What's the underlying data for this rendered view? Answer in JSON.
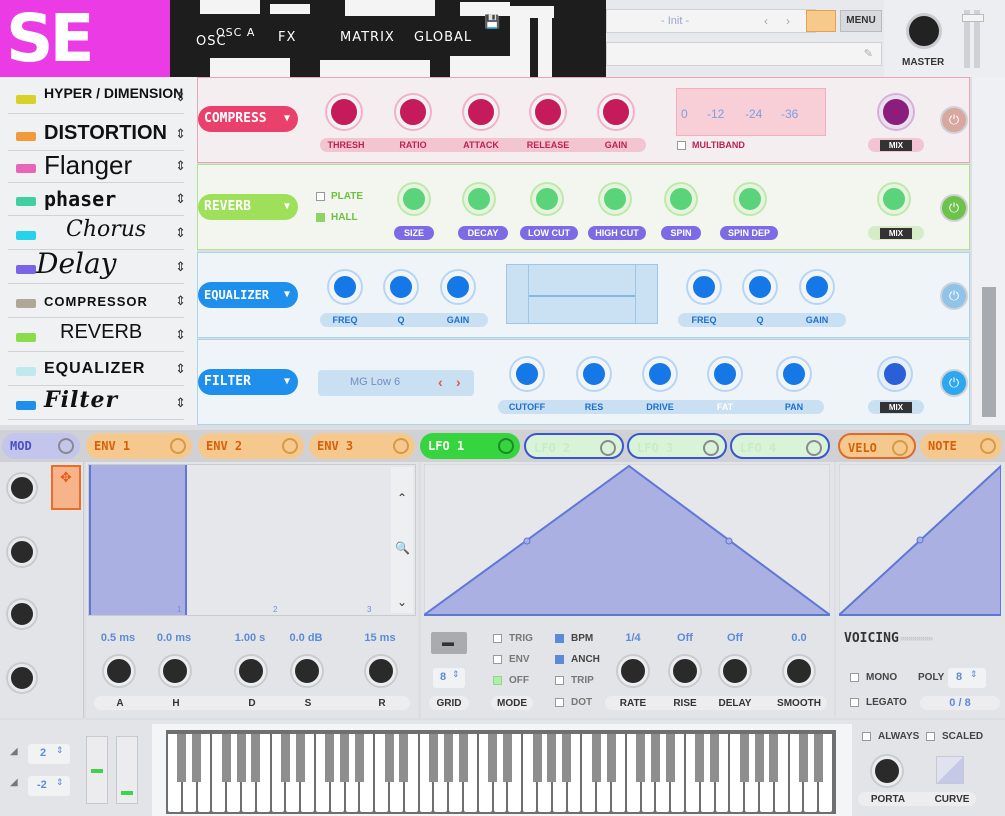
{
  "logo_text": "SE",
  "nav": {
    "osc_label": "OSC",
    "osc_sub": "OSC A",
    "fx": "FX",
    "matrix": "MATRIX",
    "global": "GLOBAL"
  },
  "preset": {
    "name": "- Init -",
    "menu": "MENU"
  },
  "master": {
    "label": "MASTER"
  },
  "fx_list": [
    {
      "name": "HYPER / DIMENSION",
      "color": "#d9d12a"
    },
    {
      "name": "DISTORTION",
      "color": "#f29a3a"
    },
    {
      "name": "Flanger",
      "color": "#e766b8"
    },
    {
      "name": "phaser",
      "color": "#3fcfa0"
    },
    {
      "name": "Chorus",
      "color": "#27d3ec"
    },
    {
      "name": "Delay",
      "color": "#7b63e6"
    },
    {
      "name": "COMPRESSOR",
      "color": "#b0a896"
    },
    {
      "name": "REVERB",
      "color": "#8bdc4a"
    },
    {
      "name": "EQUALIZER",
      "color": "#bfe9ef"
    },
    {
      "name": "Filter",
      "color": "#1f8fee"
    }
  ],
  "compress": {
    "title": "COMPRESS",
    "knobs": [
      "THRESH",
      "RATIO",
      "ATTACK",
      "RELEASE",
      "GAIN"
    ],
    "meter_scale": [
      "0",
      "-12",
      "-24",
      "-36"
    ],
    "multiband": "MULTIBAND",
    "mix": "MIX"
  },
  "reverb": {
    "title": "REVERB",
    "options": [
      "PLATE",
      "HALL"
    ],
    "knobs": [
      "SIZE",
      "DECAY",
      "LOW CUT",
      "HIGH CUT",
      "SPIN",
      "SPIN DEP"
    ],
    "mix": "MIX"
  },
  "equalizer": {
    "title": "EQUALIZER",
    "left_knobs": [
      "FREQ",
      "Q",
      "GAIN"
    ],
    "right_knobs": [
      "FREQ",
      "Q",
      "GAIN"
    ]
  },
  "filter": {
    "title": "FILTER",
    "type": "MG Low 6",
    "knobs": [
      "CUTOFF",
      "RES",
      "DRIVE",
      "FAT",
      "PAN"
    ],
    "mix": "MIX"
  },
  "mod_tabs": [
    "MOD",
    "ENV 1",
    "ENV 2",
    "ENV 3",
    "LFO 1",
    "LFO 2",
    "LFO 3",
    "LFO 4",
    "VELO",
    "NOTE"
  ],
  "env": {
    "values": [
      "0.5 ms",
      "0.0 ms",
      "1.00 s",
      "0.0 dB",
      "15 ms"
    ],
    "labels": [
      "A",
      "H",
      "D",
      "S",
      "R"
    ],
    "scale": [
      "1",
      "2",
      "3"
    ]
  },
  "lfo": {
    "grid_value": "8",
    "grid_label": "GRID",
    "modes": [
      "TRIG",
      "ENV",
      "OFF"
    ],
    "mode_label": "MODE",
    "sync": [
      "BPM",
      "ANCH",
      "TRIP",
      "DOT"
    ],
    "values": [
      "1/4",
      "Off",
      "Off",
      "0.0"
    ],
    "labels": [
      "RATE",
      "RISE",
      "DELAY",
      "SMOOTH"
    ]
  },
  "voicing": {
    "title": "VOICING",
    "mono": "MONO",
    "poly": "POLY",
    "poly_value": "8",
    "legato": "LEGATO",
    "voices": "0 / 8",
    "always": "ALWAYS",
    "scaled": "SCALED",
    "porta": "PORTA",
    "curve": "CURVE"
  },
  "octave": {
    "up": "2",
    "down": "-2"
  }
}
